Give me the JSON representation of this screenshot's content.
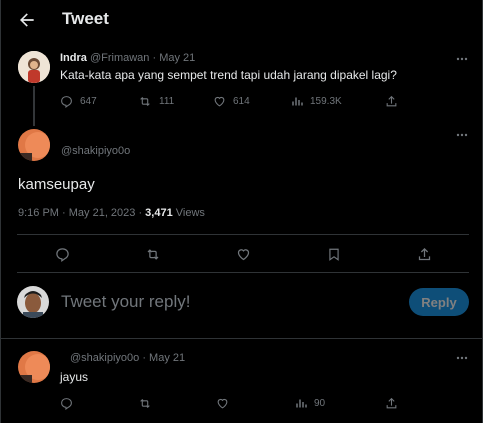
{
  "header": {
    "title": "Tweet",
    "back_icon": "arrow-left-icon"
  },
  "parent_tweet": {
    "name": "Indra",
    "handle": "@Frimawan",
    "date": "· May 21",
    "text": "Kata-kata apa yang sempet trend tapi udah jarang dipakel lagi?",
    "replies": "647",
    "retweets": "111",
    "likes": "614",
    "views": "159.3K"
  },
  "main_tweet": {
    "handle": "@shakipiyo0o",
    "text": "kamseupay",
    "time": "9:16 PM · May 21, 2023 · ",
    "views_count": "3,471",
    "views_label": " Views"
  },
  "compose": {
    "placeholder": "Tweet your reply!",
    "reply_label": "Reply"
  },
  "reply_tweet": {
    "handle": "@shakipiyo0o",
    "date": "· May 21",
    "text": "jayus",
    "views": "90"
  },
  "colors": {
    "background": "#000000",
    "text": "#e7e9ea",
    "muted": "#71767b",
    "accent": "#1d9bf0",
    "divider": "#2f3336"
  }
}
